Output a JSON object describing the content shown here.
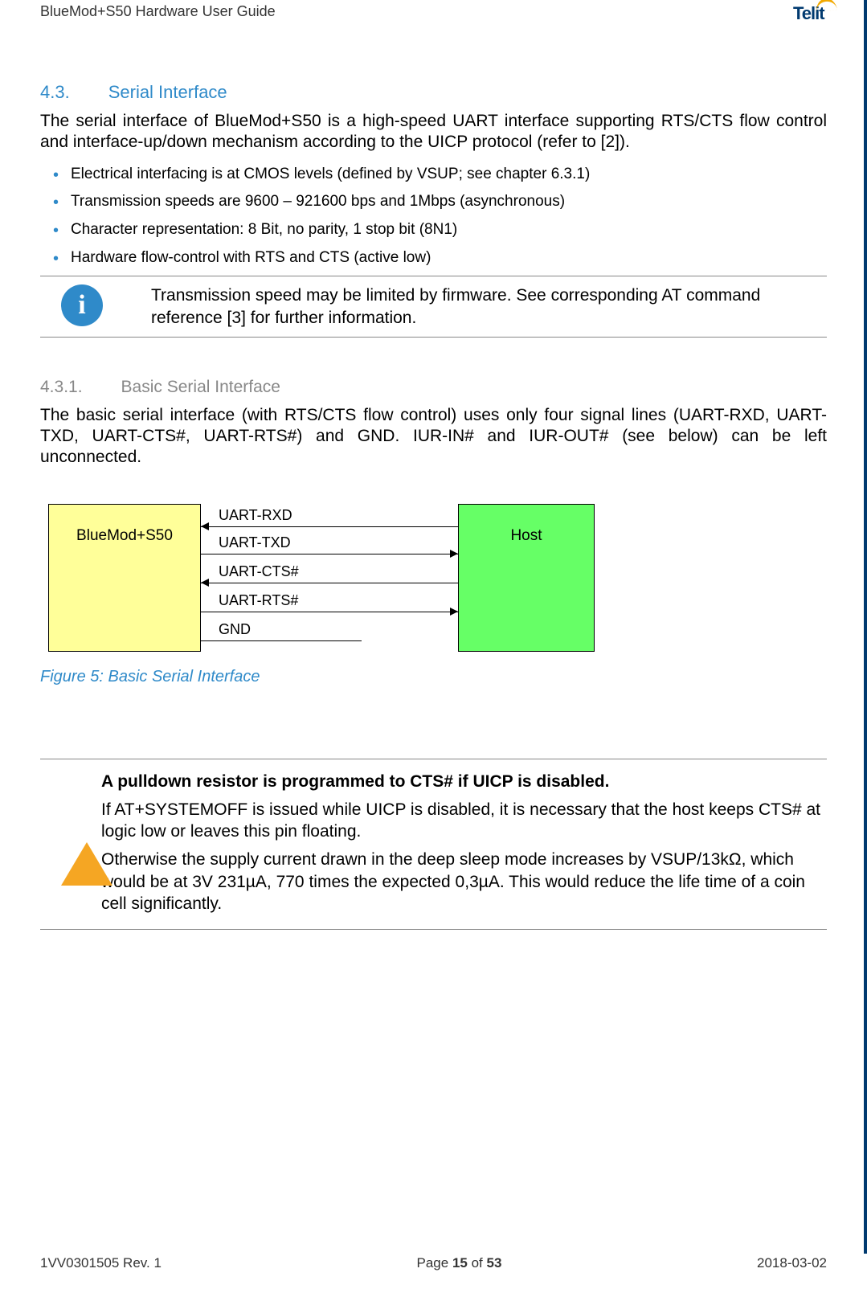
{
  "header": {
    "doc_title": "BlueMod+S50 Hardware User Guide",
    "logo_text": "Telit"
  },
  "section": {
    "number": "4.3.",
    "title": "Serial Interface"
  },
  "intro_para": "The serial interface of BlueMod+S50 is a high-speed UART interface supporting RTS/CTS flow control and interface-up/down mechanism according to the UICP protocol (refer to [2]).",
  "bullets": [
    "Electrical interfacing is at CMOS levels (defined by VSUP; see chapter 6.3.1)",
    "Transmission speeds are 9600 – 921600 bps and 1Mbps (asynchronous)",
    "Character representation: 8 Bit, no parity, 1 stop bit (8N1)",
    "Hardware flow-control with RTS and CTS (active low)"
  ],
  "info_note": "Transmission speed may be limited by firmware. See corresponding AT command reference [3] for further information.",
  "subsection": {
    "number": "4.3.1.",
    "title": "Basic Serial Interface"
  },
  "subsection_para": "The basic serial interface (with RTS/CTS flow control) uses only four signal lines (UART-RXD, UART-TXD, UART-CTS#, UART-RTS#) and GND. IUR-IN# and IUR-OUT# (see below) can be left unconnected.",
  "diagram": {
    "left_label": "BlueMod+S50",
    "right_label": "Host",
    "signals": [
      "UART-RXD",
      "UART-TXD",
      "UART-CTS#",
      "UART-RTS#",
      "GND"
    ]
  },
  "figure_caption": "Figure 5: Basic Serial Interface",
  "warning": {
    "heading": "A pulldown resistor is programmed to CTS# if UICP is disabled.",
    "p1": "If AT+SYSTEMOFF is issued while UICP is disabled, it is necessary that the host keeps CTS# at logic low or leaves this pin floating.",
    "p2": "Otherwise the supply current drawn in the deep sleep mode increases by VSUP/13kΩ, which would be at 3V 231µA, 770 times the expected 0,3µA. This would reduce the life time of a coin cell significantly."
  },
  "footer": {
    "left": "1VV0301505 Rev. 1",
    "center_prefix": "Page ",
    "center_page": "15",
    "center_of": " of ",
    "center_total": "53",
    "right": "2018-03-02"
  }
}
